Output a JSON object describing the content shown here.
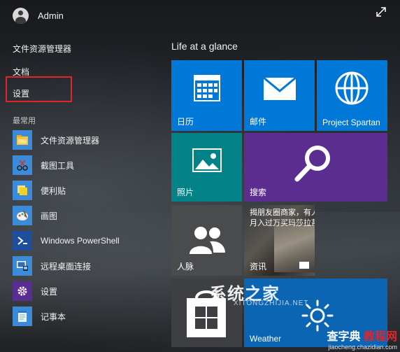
{
  "user": {
    "name": "Admin"
  },
  "places": [
    {
      "label": "文件资源管理器"
    },
    {
      "label": "文档"
    },
    {
      "label": "设置"
    }
  ],
  "most_used": {
    "title": "最常用",
    "items": [
      {
        "label": "文件资源管理器",
        "icon": "file-explorer-icon"
      },
      {
        "label": "截图工具",
        "icon": "snipping-tool-icon"
      },
      {
        "label": "便利贴",
        "icon": "sticky-notes-icon"
      },
      {
        "label": "画图",
        "icon": "paint-icon"
      },
      {
        "label": "Windows PowerShell",
        "icon": "powershell-icon"
      },
      {
        "label": "远程桌面连接",
        "icon": "remote-desktop-icon"
      },
      {
        "label": "设置",
        "icon": "gear-icon"
      },
      {
        "label": "记事本",
        "icon": "notepad-icon"
      }
    ]
  },
  "tiles_group": {
    "title": "Life at a glance",
    "tiles": {
      "calendar": {
        "label": "日历"
      },
      "mail": {
        "label": "邮件"
      },
      "spartan": {
        "label": "Project Spartan"
      },
      "photos": {
        "label": "照片"
      },
      "search": {
        "label": "搜索"
      },
      "people": {
        "label": "人脉"
      },
      "news": {
        "label": "资讯",
        "headline": "揭朋友圈商家，有人月入过万买玛莎拉蒂"
      },
      "weather": {
        "label": "Weather"
      }
    }
  },
  "watermark": {
    "title": "系统之家",
    "subtitle": "XITONGZHIJIA.NET"
  },
  "brand": {
    "name": "查字典",
    "sub": "教程网",
    "url": "jiaocheng.chazidian.com"
  },
  "colors": {
    "tile_blue": "#0078d7",
    "tile_teal": "#038387",
    "tile_purple": "#5c2d91",
    "highlight": "#e0262c"
  }
}
